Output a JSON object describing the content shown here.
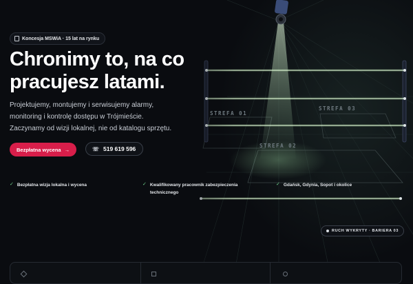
{
  "hero": {
    "badge": "Koncesja MSWiA · 15 lat na rynku",
    "title_line1": "Chronimy to, na co",
    "title_line2": "pracujesz latami.",
    "lead_line1": "Projektujemy, montujemy i serwisujemy alarmy,",
    "lead_line2": "monitoring i kontrolę dostępu w Trójmieście.",
    "lead_line3": "Zaczynamy od wizji lokalnej, nie od katalogu sprzętu.",
    "cta_primary": "Bezpłatna wycena",
    "cta_primary_arrow": "→",
    "cta_phone": "519 619 596",
    "phone_icon": "☏"
  },
  "features": [
    {
      "line1": "Bezpłatna wizja lokalna i wycena",
      "line2": ""
    },
    {
      "line1": "Kwalifikowany pracownik zabezpieczenia",
      "line2": "technicznego"
    },
    {
      "line1": "Gdańsk, Gdynia, Sopot i okolice",
      "line2": ""
    }
  ],
  "check_icon": "✓",
  "scene": {
    "zones": [
      "STREFA 01",
      "STREFA 02",
      "STREFA 03"
    ],
    "status": "RUCH WYKRYTY · BARIERA 03"
  },
  "colors": {
    "accent": "#d81e4a",
    "check": "#6fd08c",
    "beam": "#b8f0a8",
    "background": "#0a0c10"
  }
}
